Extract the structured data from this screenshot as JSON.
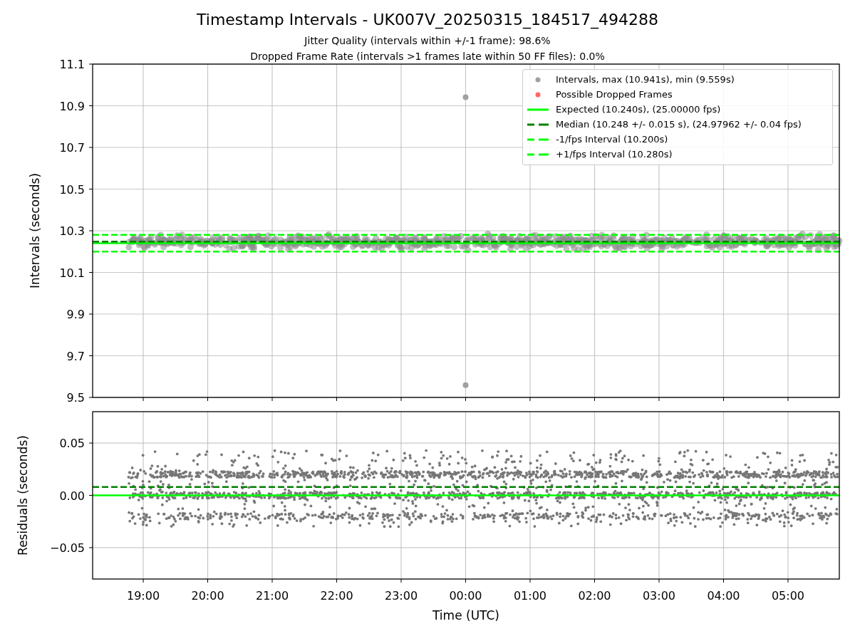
{
  "figure": {
    "title": "Timestamp Intervals - UK007V_20250315_184517_494288",
    "subtitles": [
      "Jitter Quality (intervals within +/-1 frame): 98.6%",
      "Dropped Frame Rate (intervals >1 frames late within 50 FF files): 0.0%"
    ]
  },
  "interval_plot": {
    "chart_data": {
      "type": "scatter",
      "ylabel": "Intervals (seconds)",
      "grid": true,
      "categories": [
        null,
        null,
        null,
        null,
        null,
        null,
        null,
        null,
        null,
        null,
        null
      ],
      "ylim": [
        9.5,
        11.1
      ],
      "yticks": [
        {
          "value": 9.5,
          "label": "9.5"
        },
        {
          "value": 9.7,
          "label": "9.7"
        },
        {
          "value": 9.9,
          "label": "9.9"
        },
        {
          "value": 10.1,
          "label": "10.1"
        },
        {
          "value": 10.3,
          "label": "10.3"
        },
        {
          "value": 10.5,
          "label": "10.5"
        },
        {
          "value": 10.7,
          "label": "10.7"
        },
        {
          "value": 10.9,
          "label": "10.9"
        },
        {
          "value": 11.1,
          "label": "11.1"
        }
      ],
      "series": [
        {
          "color": "#a0a0a0",
          "values": [
            null,
            null,
            null,
            null,
            null,
            10.941,
            null,
            null,
            null,
            null,
            null
          ]
        },
        {
          "color": "#a0a0a0",
          "values": [
            null,
            null,
            null,
            null,
            null,
            9.559,
            null,
            null,
            null,
            null,
            null
          ]
        }
      ],
      "ref_lines": [
        {
          "axis": "y",
          "value": 10.24,
          "color": "#00ff00"
        },
        {
          "axis": "y",
          "value": 10.248,
          "color": "#008000"
        },
        {
          "axis": "y",
          "value": 10.2,
          "color": "#00ff00"
        },
        {
          "axis": "y",
          "value": 10.28,
          "color": "#00ff00"
        }
      ]
    },
    "legend": [
      {
        "label": "Intervals, max (10.941s), min (9.559s)",
        "kind": "marker",
        "color": "#a0a0a0"
      },
      {
        "label": "Possible Dropped Frames",
        "kind": "marker",
        "color": "#ff6666"
      },
      {
        "label": "Expected (10.240s), (25.00000 fps)",
        "kind": "line",
        "color": "#00ff00"
      },
      {
        "label": "Median (10.248 +/- 0.015 s), (24.97962 +/- 0.04 fps)",
        "kind": "dashed",
        "color": "#008000"
      },
      {
        "label": "-1/fps Interval (10.200s)",
        "kind": "dashed",
        "color": "#00ff00"
      },
      {
        "label": "+1/fps Interval (10.280s)",
        "kind": "dashed",
        "color": "#00ff00"
      }
    ]
  },
  "residual_plot": {
    "chart_data": {
      "type": "scatter",
      "xlabel": "Time (UTC)",
      "ylabel": "Residuals (seconds)",
      "grid": true,
      "categories": [
        "19:00",
        "20:00",
        "21:00",
        "22:00",
        "23:00",
        "00:00",
        "01:00",
        "02:00",
        "03:00",
        "04:00",
        "05:00"
      ],
      "ylim": [
        -0.08,
        0.08
      ],
      "yticks": [
        {
          "value": -0.05,
          "label": "−0.05"
        },
        {
          "value": 0,
          "label": "0.00"
        },
        {
          "value": 0.05,
          "label": "0.05"
        }
      ],
      "ref_lines": [
        {
          "axis": "y",
          "value": 0.008,
          "color": "#008000"
        },
        {
          "axis": "y",
          "value": 0,
          "color": "#00ff00"
        }
      ]
    }
  }
}
